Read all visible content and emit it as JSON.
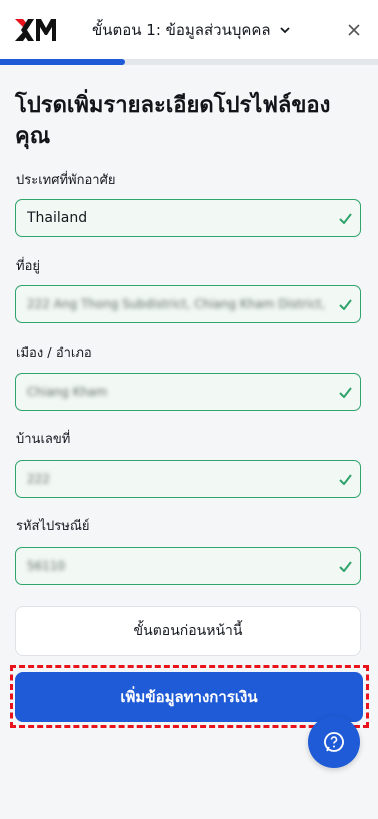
{
  "header": {
    "logo_text": "XM",
    "step_title": "ขั้นตอน 1: ข้อมูลส่วนบุคคล",
    "progress_fraction": 0.33
  },
  "page_title": "โปรดเพิ่มรายละเอียดโปรไฟล์ของคุณ",
  "fields": {
    "country": {
      "label": "ประเทศที่พักอาศัย",
      "value": "Thailand"
    },
    "address": {
      "label": "ที่อยู่",
      "value": "222 Ang Thong Subdistrict, Chiang Kham District,"
    },
    "city": {
      "label": "เมือง / อำเภอ",
      "value": "Chiang Kham"
    },
    "house_no": {
      "label": "บ้านเลขที่",
      "value": "222"
    },
    "postal": {
      "label": "รหัสไปรษณีย์",
      "value": "56110"
    }
  },
  "buttons": {
    "previous": "ขั้นตอนก่อนหน้านี้",
    "next": "เพิ่มข้อมูลทางการเงิน"
  },
  "colors": {
    "primary": "#1f5bd6",
    "valid_border": "#2ea36b",
    "highlight": "#e8131b"
  },
  "icons": [
    "xm-logo",
    "chevron-down-icon",
    "close-icon",
    "check-icon",
    "chat-help-icon"
  ]
}
